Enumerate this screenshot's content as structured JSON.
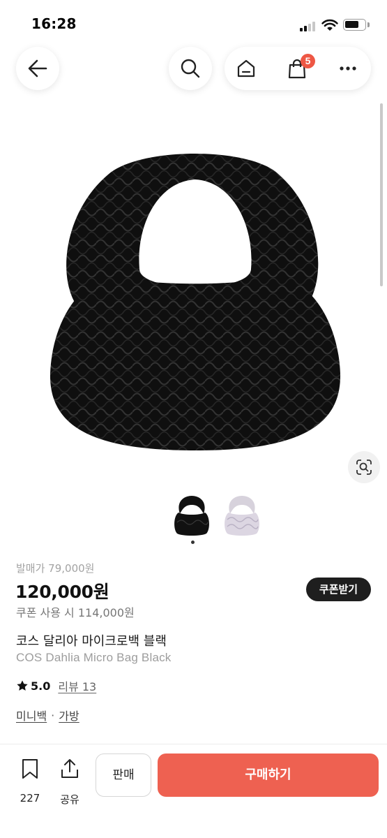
{
  "status_bar": {
    "time": "16:28"
  },
  "header": {
    "cart_count": "5"
  },
  "gallery": {
    "thumbnail_count": 2,
    "active_index": 0
  },
  "product": {
    "release_price": "발매가 79,000원",
    "price": "120,000원",
    "coupon_button": "쿠폰받기",
    "coupon_price": "쿠폰 사용 시 114,000원",
    "name_ko": "코스 달리아 마이크로백 블랙",
    "name_en": "COS Dahlia Micro Bag Black",
    "rating": "5.0",
    "review_link": "리뷰 13",
    "tags": [
      "미니백",
      "가방"
    ],
    "tag_separator": "·"
  },
  "bottom_bar": {
    "bookmark_count": "227",
    "share_label": "공유",
    "sell_label": "판매",
    "buy_label": "구매하기"
  },
  "colors": {
    "accent": "#ee6151",
    "badge": "#ee5744",
    "dark_button": "#1e1e1e"
  }
}
